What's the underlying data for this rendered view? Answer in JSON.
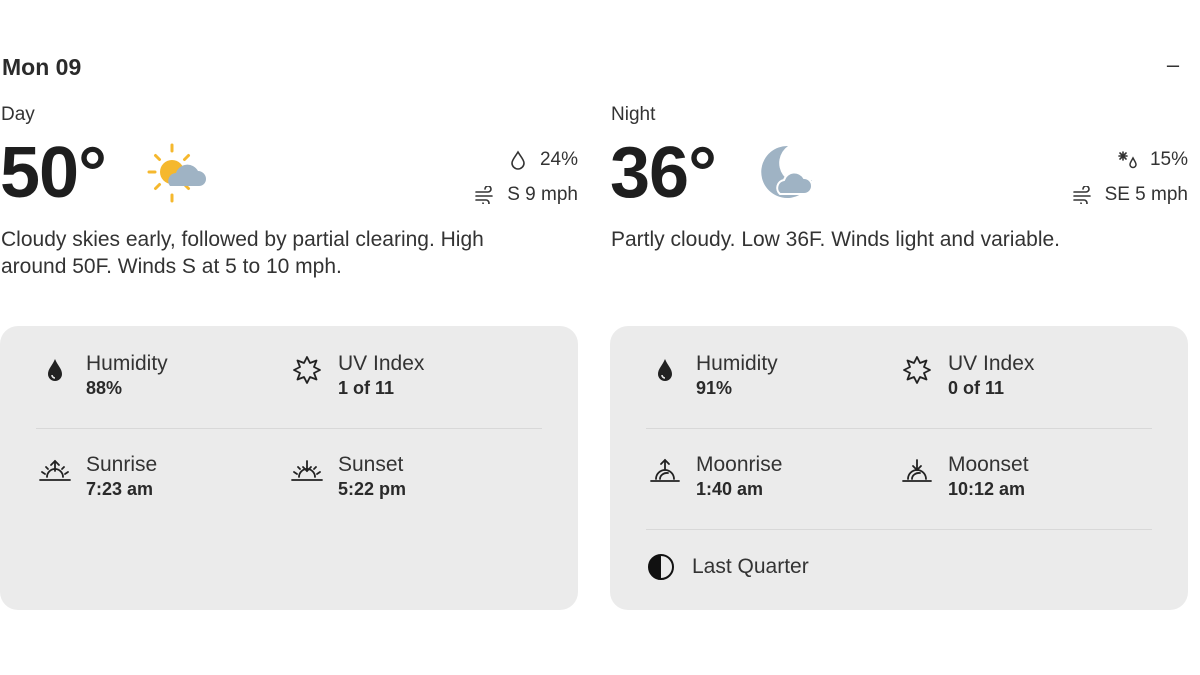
{
  "date_label": "Mon 09",
  "collapse_symbol": "–",
  "day": {
    "period": "Day",
    "temperature": "50°",
    "icon": "partly-cloudy-sun-icon",
    "precip_chance": "24%",
    "wind": "S 9 mph",
    "description": "Cloudy skies early, followed by partial clearing. High around 50F. Winds S at 5 to 10 mph.",
    "humidity": {
      "label": "Humidity",
      "value": "88%"
    },
    "uv": {
      "label": "UV Index",
      "value": "1 of 11"
    },
    "rise": {
      "label": "Sunrise",
      "value": "7:23 am"
    },
    "set": {
      "label": "Sunset",
      "value": "5:22 pm"
    }
  },
  "night": {
    "period": "Night",
    "temperature": "36°",
    "icon": "partly-cloudy-moon-icon",
    "precip_chance": "15%",
    "wind": "SE 5 mph",
    "description": "Partly cloudy. Low 36F. Winds light and variable.",
    "humidity": {
      "label": "Humidity",
      "value": "91%"
    },
    "uv": {
      "label": "UV Index",
      "value": "0 of 11"
    },
    "rise": {
      "label": "Moonrise",
      "value": "1:40 am"
    },
    "set": {
      "label": "Moonset",
      "value": "10:12 am"
    },
    "moon_phase": "Last Quarter"
  },
  "colors": {
    "sun": "#F5B82E",
    "cloud": "#9FB3C4",
    "card_bg": "#EBEBEB"
  }
}
